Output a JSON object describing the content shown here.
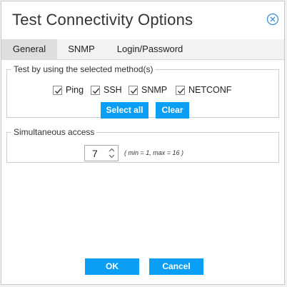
{
  "dialog": {
    "title": "Test Connectivity Options"
  },
  "tabs": [
    {
      "label": "General",
      "active": true
    },
    {
      "label": "SNMP",
      "active": false
    },
    {
      "label": "Login/Password",
      "active": false
    }
  ],
  "method_group": {
    "legend": "Test by using the selected method(s)",
    "methods": [
      {
        "label": "Ping",
        "checked": true
      },
      {
        "label": "SSH",
        "checked": true
      },
      {
        "label": "SNMP",
        "checked": true
      },
      {
        "label": "NETCONF",
        "checked": true
      }
    ],
    "select_all_label": "Select all",
    "clear_label": "Clear"
  },
  "access_group": {
    "legend": "Simultaneous access",
    "value": "7",
    "range_text": "( min = 1, max = 16 )"
  },
  "footer": {
    "ok_label": "OK",
    "cancel_label": "Cancel"
  },
  "colors": {
    "accent": "#0a9ef5",
    "close_icon": "#3b8fd6"
  },
  "icons": {
    "close": "close-circle-icon",
    "check": "check-icon",
    "spinner": "spinner-arrows-icon"
  }
}
